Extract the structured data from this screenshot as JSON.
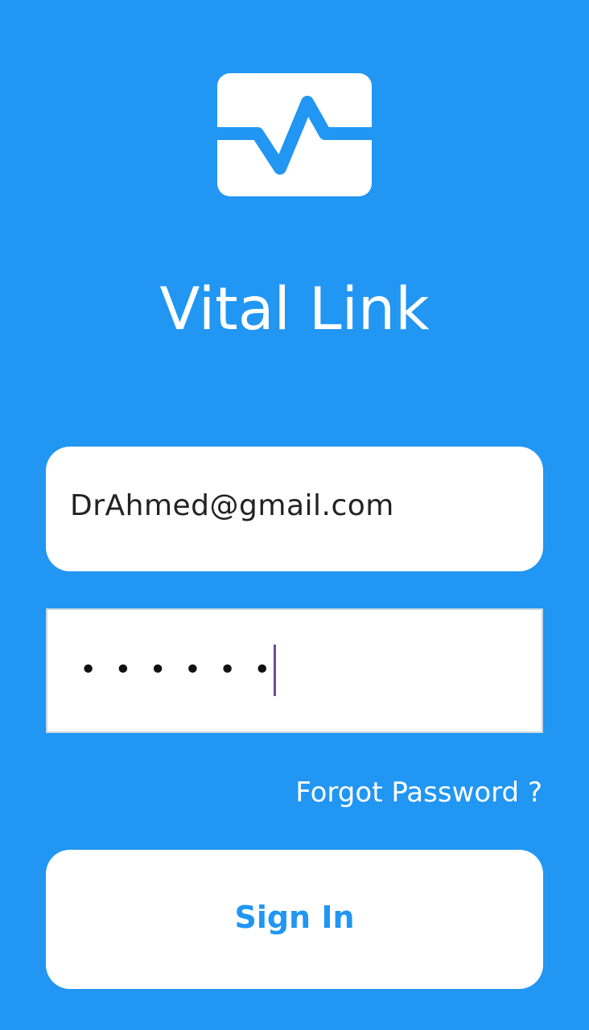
{
  "app": {
    "title": "Vital Link",
    "logo_icon": "heartbeat-monitor-icon"
  },
  "login_form": {
    "email_value": "DrAhmed@gmail.com",
    "password_mask": "••••••",
    "forgot_password_label": "Forgot Password ?",
    "sign_in_label": "Sign In"
  },
  "colors": {
    "background": "#2196F3",
    "accent": "#2196F3",
    "surface": "#FFFFFF",
    "caret": "#6A4A9A"
  }
}
